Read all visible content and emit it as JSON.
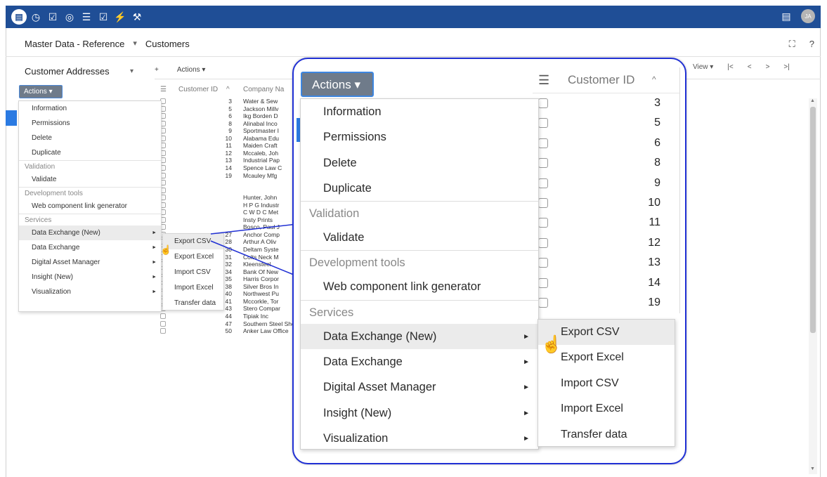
{
  "topbar": {
    "icons": [
      "database-icon",
      "clock-icon",
      "checkbox-icon",
      "gauge-icon",
      "list-check-icon",
      "checkbox-edit-icon",
      "plug-icon",
      "wrench-icon"
    ],
    "avatar_initials": "JA",
    "accent": "#1f4e96"
  },
  "breadcrumb": {
    "section": "Master Data - Reference",
    "page": "Customers",
    "sep": "▾"
  },
  "left_panel": {
    "title": "Customer Addresses",
    "actions_label": "Actions ▾"
  },
  "small_menu": {
    "items": [
      "Information",
      "Permissions",
      "Delete",
      "Duplicate"
    ],
    "group_validation": "Validation",
    "validate": "Validate",
    "group_dev": "Development tools",
    "dev_item": "Web component link generator",
    "group_services": "Services",
    "services": [
      "Data Exchange (New)",
      "Data Exchange",
      "Digital Asset Manager",
      "Insight (New)",
      "Visualization"
    ],
    "submenu": [
      "Export CSV",
      "Export Excel",
      "Import CSV",
      "Import Excel",
      "Transfer data"
    ]
  },
  "table": {
    "toolbar_add": "+",
    "toolbar_actions": "Actions ▾",
    "col_customer_id": "Customer ID",
    "col_company": "Company Na",
    "view_label": "View ▾",
    "rows": [
      {
        "id": "3",
        "name": "Water & Sew"
      },
      {
        "id": "5",
        "name": "Jackson Millv"
      },
      {
        "id": "6",
        "name": "Ikg Borden D"
      },
      {
        "id": "8",
        "name": "Alinabal Inco"
      },
      {
        "id": "9",
        "name": "Sportmaster I"
      },
      {
        "id": "10",
        "name": "Alabama Edu"
      },
      {
        "id": "11",
        "name": "Maiden Craft"
      },
      {
        "id": "12",
        "name": "Mccaleb, Joh"
      },
      {
        "id": "13",
        "name": "Industrial Pap"
      },
      {
        "id": "14",
        "name": "Spence Law C"
      },
      {
        "id": "19",
        "name": "Mcauley Mfg"
      },
      {
        "id": "",
        "name": ""
      },
      {
        "id": "",
        "name": ""
      },
      {
        "id": "",
        "name": "Hunter, John"
      },
      {
        "id": "",
        "name": "H P G Industr"
      },
      {
        "id": "",
        "name": "C W D C Met"
      },
      {
        "id": "",
        "name": "Insty Prints"
      },
      {
        "id": "",
        "name": "Bosco, Paul J"
      },
      {
        "id": "27",
        "name": "Anchor Comp"
      },
      {
        "id": "28",
        "name": "Arthur A Oliv"
      },
      {
        "id": "30",
        "name": "Deltam Syste"
      },
      {
        "id": "31",
        "name": "Colts Neck M"
      },
      {
        "id": "32",
        "name": "Kleensteel"
      },
      {
        "id": "34",
        "name": "Bank Of New"
      },
      {
        "id": "35",
        "name": "Harris Corpor"
      },
      {
        "id": "38",
        "name": "Silver Bros In"
      },
      {
        "id": "40",
        "name": "Northwest Pu"
      },
      {
        "id": "41",
        "name": "Mccorkle, Tor"
      },
      {
        "id": "43",
        "name": "Stero Compar"
      },
      {
        "id": "44",
        "name": "Tipiak Inc"
      },
      {
        "id": "47",
        "name": "Southern Steel Shearing Co"
      },
      {
        "id": "50",
        "name": "Anker Law Office"
      }
    ]
  },
  "zoom": {
    "actions_label": "Actions ▾",
    "col_header": "Customer ID",
    "ids": [
      "3",
      "5",
      "6",
      "8",
      "9",
      "10",
      "11",
      "12",
      "13",
      "14",
      "19"
    ]
  }
}
